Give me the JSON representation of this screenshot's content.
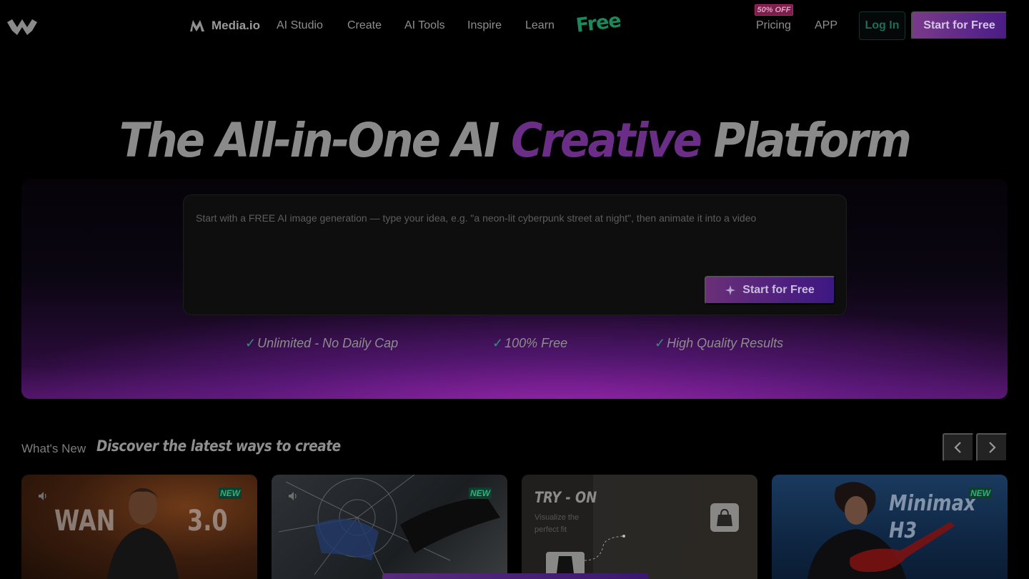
{
  "nav": {
    "product_name": "Media.io",
    "links": [
      "AI Studio",
      "Create",
      "AI Tools",
      "Inspire",
      "Learn"
    ],
    "free_tag": "Free",
    "pricing_badge": "50% OFF",
    "pricing": "Pricing",
    "app": "APP",
    "login": "Log In",
    "start": "Start for Free"
  },
  "hero": {
    "title_before": "The All-in-One AI ",
    "title_accent": "Creative",
    "title_after": " Platform",
    "prompt_placeholder": "Start with a FREE AI image generation — type your idea, e.g. \"a neon-lit cyberpunk street at night\", then animate it into a video",
    "button": "Start for Free",
    "features": [
      "Unlimited - No Daily Cap",
      "100% Free",
      "High Quality Results"
    ]
  },
  "whats_new": {
    "label": "What's New",
    "subtitle": "Discover the latest ways to create",
    "cards": [
      {
        "badge": "NEW",
        "word_left": "WAN",
        "word_right": "3.0"
      },
      {
        "badge": "NEW"
      },
      {
        "title": "TRY - ON",
        "subtitle": "Visualize the perfect fit"
      },
      {
        "badge": "NEW",
        "title_line1": "Minimax",
        "title_line2": "H3"
      }
    ]
  },
  "colors": {
    "accent_purple": "#6b2e86",
    "login_green": "#1f6d55",
    "new_badge": "#2fb07c"
  }
}
